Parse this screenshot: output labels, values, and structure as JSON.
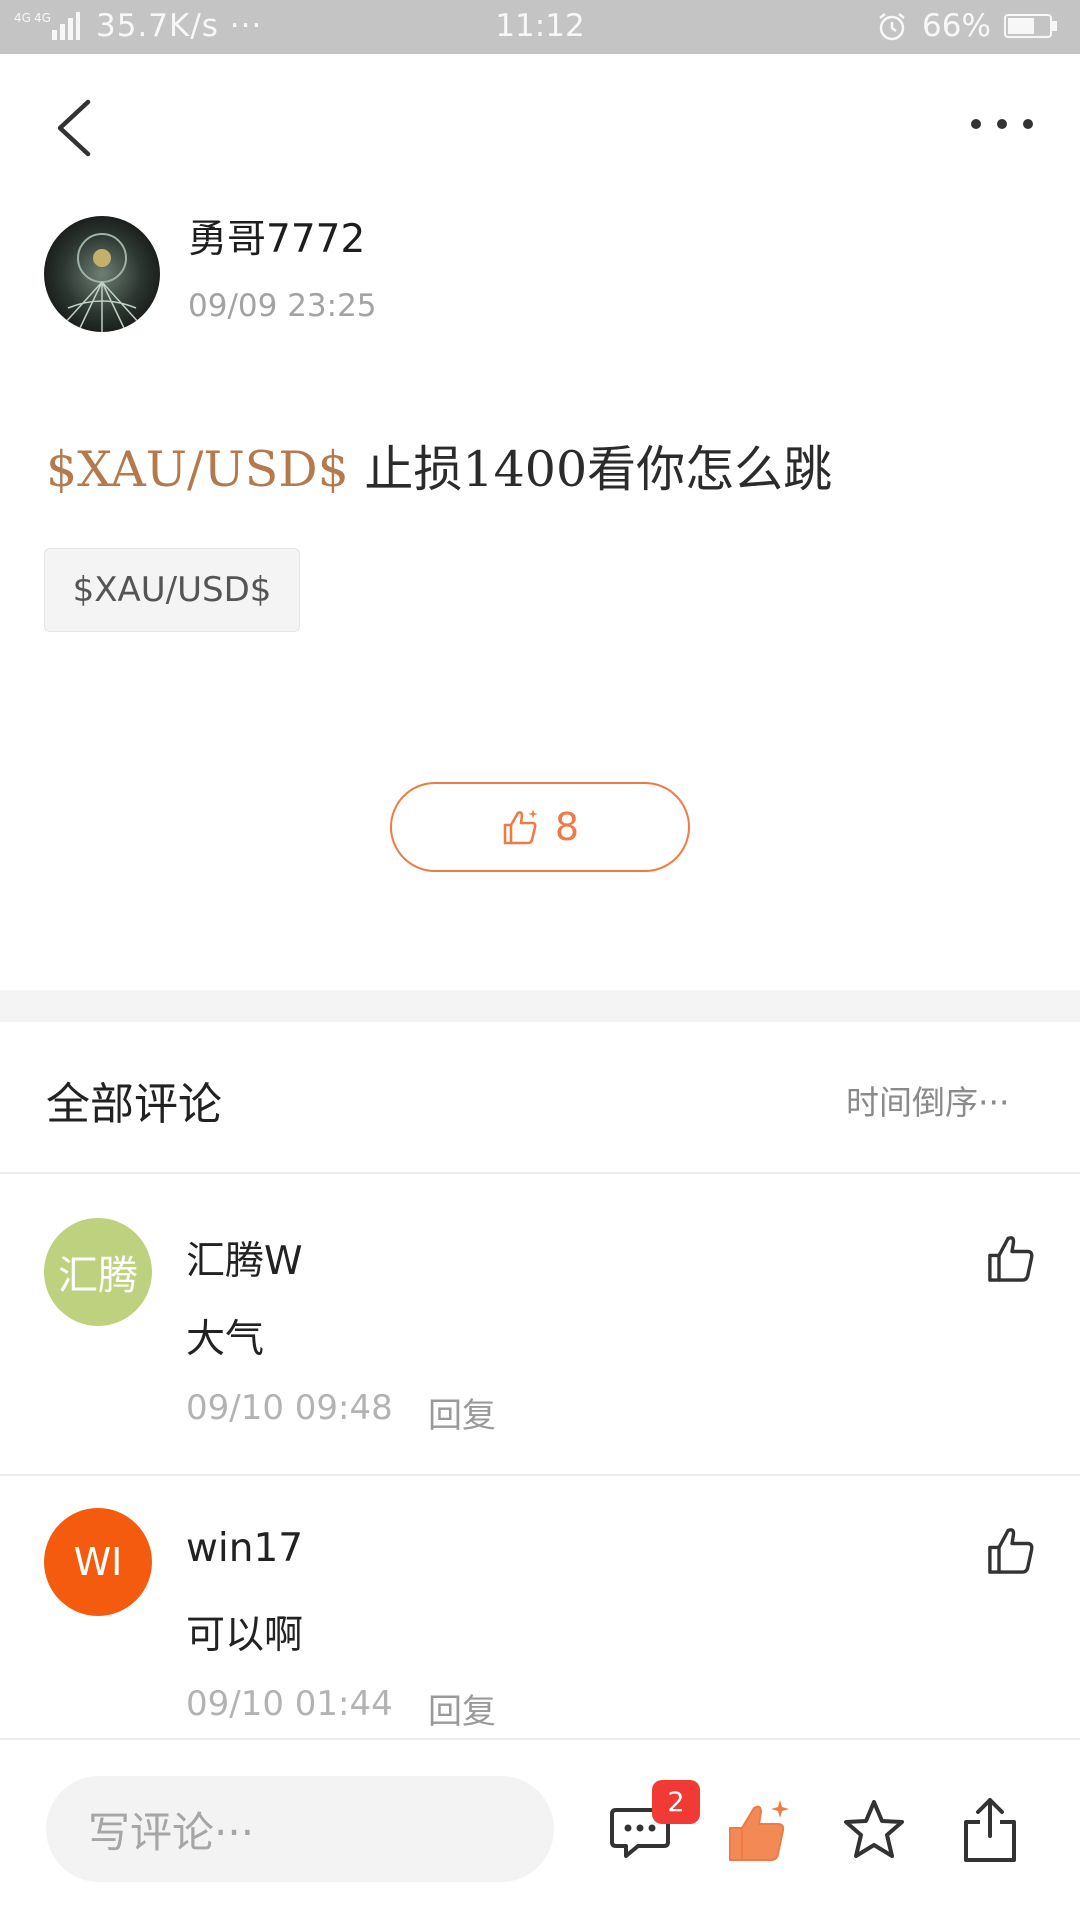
{
  "status_bar": {
    "network": "4G 4G",
    "speed": "35.7K/s ···",
    "time": "11:12",
    "battery_pct": "66%",
    "battery_level": 0.66
  },
  "nav": {
    "back_icon": "chevron-left-icon",
    "more_icon": "more-dots-icon"
  },
  "post": {
    "author": "勇哥7772",
    "time": "09/09 23:25",
    "symbol": "$XAU/USD$",
    "text": "止损1400看你怎么跳",
    "tag": "$XAU/USD$",
    "like_count": "8"
  },
  "comments": {
    "title": "全部评论",
    "sort": "时间倒序···",
    "items": [
      {
        "avatar_text": "汇腾",
        "avatar_color": "#bdd17f",
        "name": "汇腾W",
        "text": "大气",
        "time": "09/10 09:48",
        "reply": "回复"
      },
      {
        "avatar_text": "WI",
        "avatar_color": "#f45b0e",
        "name": "win17",
        "text": "可以啊",
        "time": "09/10 01:44",
        "reply": "回复"
      }
    ]
  },
  "bottom_bar": {
    "input_placeholder": "写评论···",
    "comment_badge": "2",
    "accent_color": "#f07a45"
  }
}
